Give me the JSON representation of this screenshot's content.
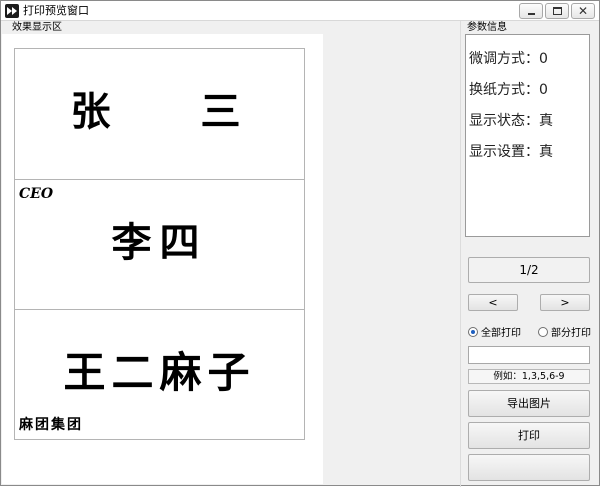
{
  "window": {
    "title": "打印预览窗口",
    "controls": [
      "minimize-icon",
      "maximize-icon",
      "close-icon"
    ],
    "close_glyph": "✕"
  },
  "preview": {
    "group_label": "效果显示区",
    "cards": [
      {
        "name": "张 三",
        "tag": ""
      },
      {
        "name": "李四",
        "tag": "CEO"
      },
      {
        "name": "王二麻子",
        "tag": "麻团集团"
      }
    ]
  },
  "params": {
    "group_label": "参数信息",
    "items": [
      "微调方式：0",
      "换纸方式：0",
      "显示状态：真",
      "显示设置：真"
    ]
  },
  "controls": {
    "page_indicator": "1/2",
    "prev_label": "<",
    "next_label": ">",
    "radio_all": "全部打印",
    "radio_partial": "部分打印",
    "radio_selected": "全部打印",
    "page_input_value": "",
    "hint": "例如：1,3,5,6-9",
    "export_label": "导出图片",
    "print_label": "打印",
    "blank_label": ""
  },
  "colors": {
    "window_bg": "#f0f0f0",
    "preview_bg": "#ffffff",
    "radio_accent": "#1f5fbf"
  }
}
